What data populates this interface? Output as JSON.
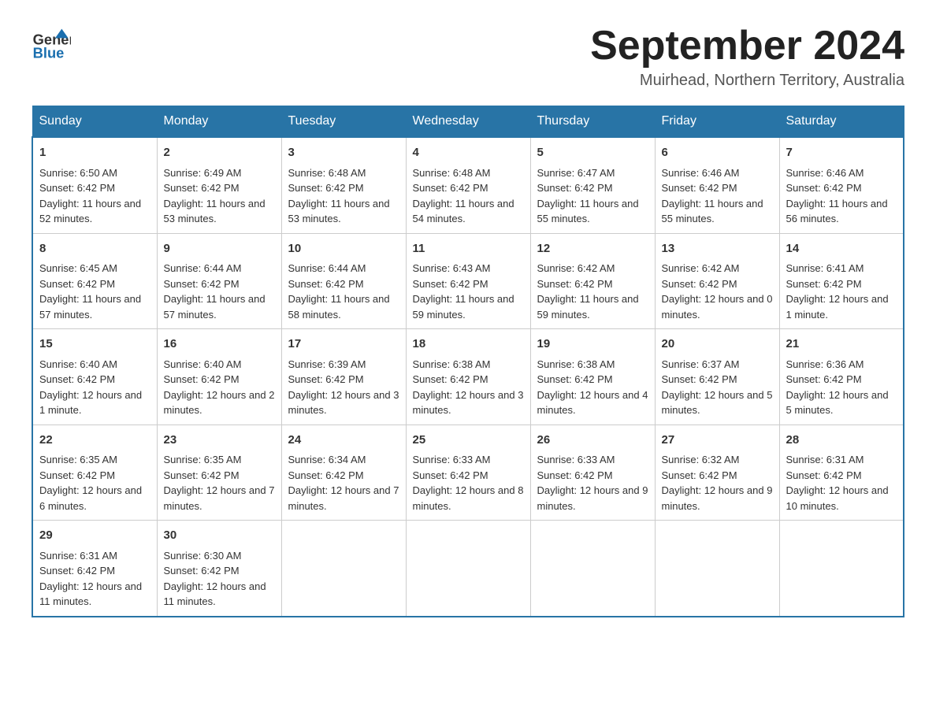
{
  "header": {
    "logo": {
      "line1": "General",
      "line2": "Blue"
    },
    "title": "September 2024",
    "subtitle": "Muirhead, Northern Territory, Australia"
  },
  "weekdays": [
    "Sunday",
    "Monday",
    "Tuesday",
    "Wednesday",
    "Thursday",
    "Friday",
    "Saturday"
  ],
  "weeks": [
    [
      {
        "day": "1",
        "sunrise": "6:50 AM",
        "sunset": "6:42 PM",
        "daylight": "11 hours and 52 minutes."
      },
      {
        "day": "2",
        "sunrise": "6:49 AM",
        "sunset": "6:42 PM",
        "daylight": "11 hours and 53 minutes."
      },
      {
        "day": "3",
        "sunrise": "6:48 AM",
        "sunset": "6:42 PM",
        "daylight": "11 hours and 53 minutes."
      },
      {
        "day": "4",
        "sunrise": "6:48 AM",
        "sunset": "6:42 PM",
        "daylight": "11 hours and 54 minutes."
      },
      {
        "day": "5",
        "sunrise": "6:47 AM",
        "sunset": "6:42 PM",
        "daylight": "11 hours and 55 minutes."
      },
      {
        "day": "6",
        "sunrise": "6:46 AM",
        "sunset": "6:42 PM",
        "daylight": "11 hours and 55 minutes."
      },
      {
        "day": "7",
        "sunrise": "6:46 AM",
        "sunset": "6:42 PM",
        "daylight": "11 hours and 56 minutes."
      }
    ],
    [
      {
        "day": "8",
        "sunrise": "6:45 AM",
        "sunset": "6:42 PM",
        "daylight": "11 hours and 57 minutes."
      },
      {
        "day": "9",
        "sunrise": "6:44 AM",
        "sunset": "6:42 PM",
        "daylight": "11 hours and 57 minutes."
      },
      {
        "day": "10",
        "sunrise": "6:44 AM",
        "sunset": "6:42 PM",
        "daylight": "11 hours and 58 minutes."
      },
      {
        "day": "11",
        "sunrise": "6:43 AM",
        "sunset": "6:42 PM",
        "daylight": "11 hours and 59 minutes."
      },
      {
        "day": "12",
        "sunrise": "6:42 AM",
        "sunset": "6:42 PM",
        "daylight": "11 hours and 59 minutes."
      },
      {
        "day": "13",
        "sunrise": "6:42 AM",
        "sunset": "6:42 PM",
        "daylight": "12 hours and 0 minutes."
      },
      {
        "day": "14",
        "sunrise": "6:41 AM",
        "sunset": "6:42 PM",
        "daylight": "12 hours and 1 minute."
      }
    ],
    [
      {
        "day": "15",
        "sunrise": "6:40 AM",
        "sunset": "6:42 PM",
        "daylight": "12 hours and 1 minute."
      },
      {
        "day": "16",
        "sunrise": "6:40 AM",
        "sunset": "6:42 PM",
        "daylight": "12 hours and 2 minutes."
      },
      {
        "day": "17",
        "sunrise": "6:39 AM",
        "sunset": "6:42 PM",
        "daylight": "12 hours and 3 minutes."
      },
      {
        "day": "18",
        "sunrise": "6:38 AM",
        "sunset": "6:42 PM",
        "daylight": "12 hours and 3 minutes."
      },
      {
        "day": "19",
        "sunrise": "6:38 AM",
        "sunset": "6:42 PM",
        "daylight": "12 hours and 4 minutes."
      },
      {
        "day": "20",
        "sunrise": "6:37 AM",
        "sunset": "6:42 PM",
        "daylight": "12 hours and 5 minutes."
      },
      {
        "day": "21",
        "sunrise": "6:36 AM",
        "sunset": "6:42 PM",
        "daylight": "12 hours and 5 minutes."
      }
    ],
    [
      {
        "day": "22",
        "sunrise": "6:35 AM",
        "sunset": "6:42 PM",
        "daylight": "12 hours and 6 minutes."
      },
      {
        "day": "23",
        "sunrise": "6:35 AM",
        "sunset": "6:42 PM",
        "daylight": "12 hours and 7 minutes."
      },
      {
        "day": "24",
        "sunrise": "6:34 AM",
        "sunset": "6:42 PM",
        "daylight": "12 hours and 7 minutes."
      },
      {
        "day": "25",
        "sunrise": "6:33 AM",
        "sunset": "6:42 PM",
        "daylight": "12 hours and 8 minutes."
      },
      {
        "day": "26",
        "sunrise": "6:33 AM",
        "sunset": "6:42 PM",
        "daylight": "12 hours and 9 minutes."
      },
      {
        "day": "27",
        "sunrise": "6:32 AM",
        "sunset": "6:42 PM",
        "daylight": "12 hours and 9 minutes."
      },
      {
        "day": "28",
        "sunrise": "6:31 AM",
        "sunset": "6:42 PM",
        "daylight": "12 hours and 10 minutes."
      }
    ],
    [
      {
        "day": "29",
        "sunrise": "6:31 AM",
        "sunset": "6:42 PM",
        "daylight": "12 hours and 11 minutes."
      },
      {
        "day": "30",
        "sunrise": "6:30 AM",
        "sunset": "6:42 PM",
        "daylight": "12 hours and 11 minutes."
      },
      null,
      null,
      null,
      null,
      null
    ]
  ],
  "labels": {
    "sunrise": "Sunrise:",
    "sunset": "Sunset:",
    "daylight": "Daylight:"
  }
}
